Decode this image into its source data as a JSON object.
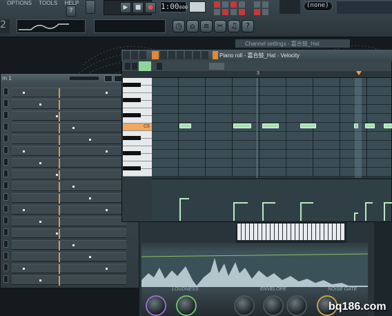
{
  "topbar": {
    "menu_items": [
      "OPTIONS",
      "TOOLS",
      "HELP"
    ],
    "time_display": "1:00",
    "time_suffix": "000",
    "pattern_selector": "(none)",
    "transport": {
      "play": "▶",
      "stop": "■",
      "record": "●"
    },
    "tool_icons": [
      "clock-icon",
      "plugin-icon",
      "mixer-icon",
      "scissors-icon",
      "piano-icon",
      "help-icon"
    ]
  },
  "channel_rack": {
    "title": "rn 1",
    "active_rows": 17
  },
  "channel_settings": {
    "title": "Channel settings - 嘉合鼓_Hat"
  },
  "piano_roll": {
    "title": "Piano roll - 嘉合鼓_Hat",
    "target": "Velocity",
    "bar_marker": "3",
    "note_label": "C5",
    "notes": [
      {
        "start": 0.5,
        "length": 0.6,
        "velocity": 0.55
      },
      {
        "start": 2.5,
        "length": 0.9,
        "velocity": 0.45
      },
      {
        "start": 3.6,
        "length": 0.8,
        "velocity": 0.45
      },
      {
        "start": 5.0,
        "length": 0.8,
        "velocity": 0.45
      },
      {
        "start": 7.0,
        "length": 0.2,
        "velocity": 0.2
      },
      {
        "start": 7.4,
        "length": 0.5,
        "velocity": 0.45
      },
      {
        "start": 8.1,
        "length": 0.5,
        "velocity": 0.45
      }
    ]
  },
  "plugin": {
    "labels": [
      "LOUDNESS",
      "ENVELOPE",
      "NOISE GATE"
    ]
  },
  "watermark": "bq186.com",
  "colors": {
    "note": "#a7e0b1",
    "accent": "#ff9a3c",
    "grid": "#3a4d54"
  }
}
